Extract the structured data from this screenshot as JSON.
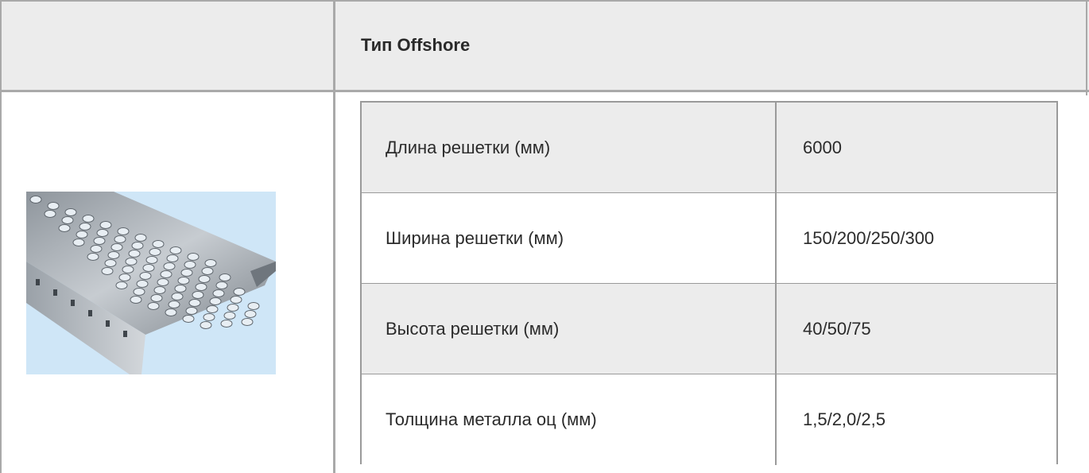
{
  "header": {
    "title": "Тип Offshore"
  },
  "product": {
    "image_name": "perforated-cable-tray-image",
    "image_background": "#cfe6f7"
  },
  "specs": [
    {
      "label": "Длина решетки (мм)",
      "value": "6000"
    },
    {
      "label": "Ширина решетки (мм)",
      "value": "150/200/250/300"
    },
    {
      "label": "Высота решетки (мм)",
      "value": "40/50/75"
    },
    {
      "label": "Толщина металла оц (мм)",
      "value": "1,5/2,0/2,5"
    }
  ],
  "colors": {
    "header_bg": "#ececec",
    "row_shaded": "#ececec",
    "row_plain": "#ffffff",
    "border": "#9a9a9a"
  }
}
